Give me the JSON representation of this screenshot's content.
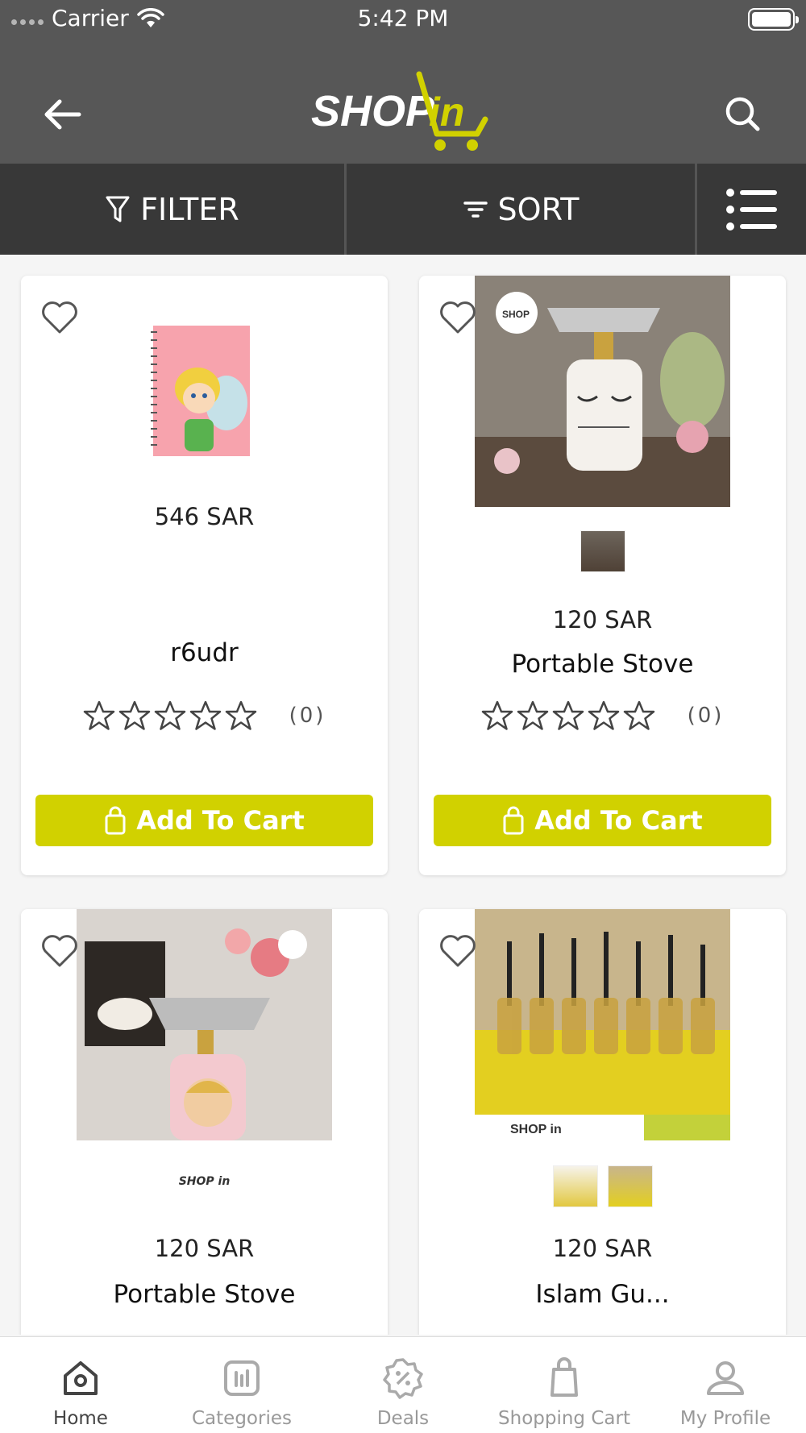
{
  "status_bar": {
    "carrier": "Carrier",
    "time": "5:42 PM"
  },
  "header": {
    "logo_text_shop": "SHOP",
    "logo_text_in": "in"
  },
  "toolbar": {
    "filter_label": "FILTER",
    "sort_label": "SORT"
  },
  "colors": {
    "header": "#575757",
    "toolbar": "#383838",
    "accent": "#d1d100"
  },
  "products": [
    {
      "price": "546 SAR",
      "name": "r6udr",
      "rating_count": "(0)",
      "add_label": "Add To Cart",
      "image": "tinkerbell-notebook"
    },
    {
      "price": "120 SAR",
      "name": "Portable Stove",
      "rating_count": "(0)",
      "add_label": "Add To Cart",
      "image": "white-stove",
      "thumbs": 1
    },
    {
      "price": "120 SAR",
      "name": "Portable Stove",
      "image": "vintage-stove",
      "logo_thumb": "SHOP in"
    },
    {
      "price": "120 SAR",
      "name": "Islam Gu...",
      "image": "yellow-gift-bottles",
      "thumbs": 2
    }
  ],
  "tabbar": {
    "items": [
      {
        "label": "Home",
        "icon": "home-icon",
        "active": true
      },
      {
        "label": "Categories",
        "icon": "categories-icon"
      },
      {
        "label": "Deals",
        "icon": "deals-icon"
      },
      {
        "label": "Shopping Cart",
        "icon": "bag-icon"
      },
      {
        "label": "My Profile",
        "icon": "profile-icon"
      }
    ]
  }
}
